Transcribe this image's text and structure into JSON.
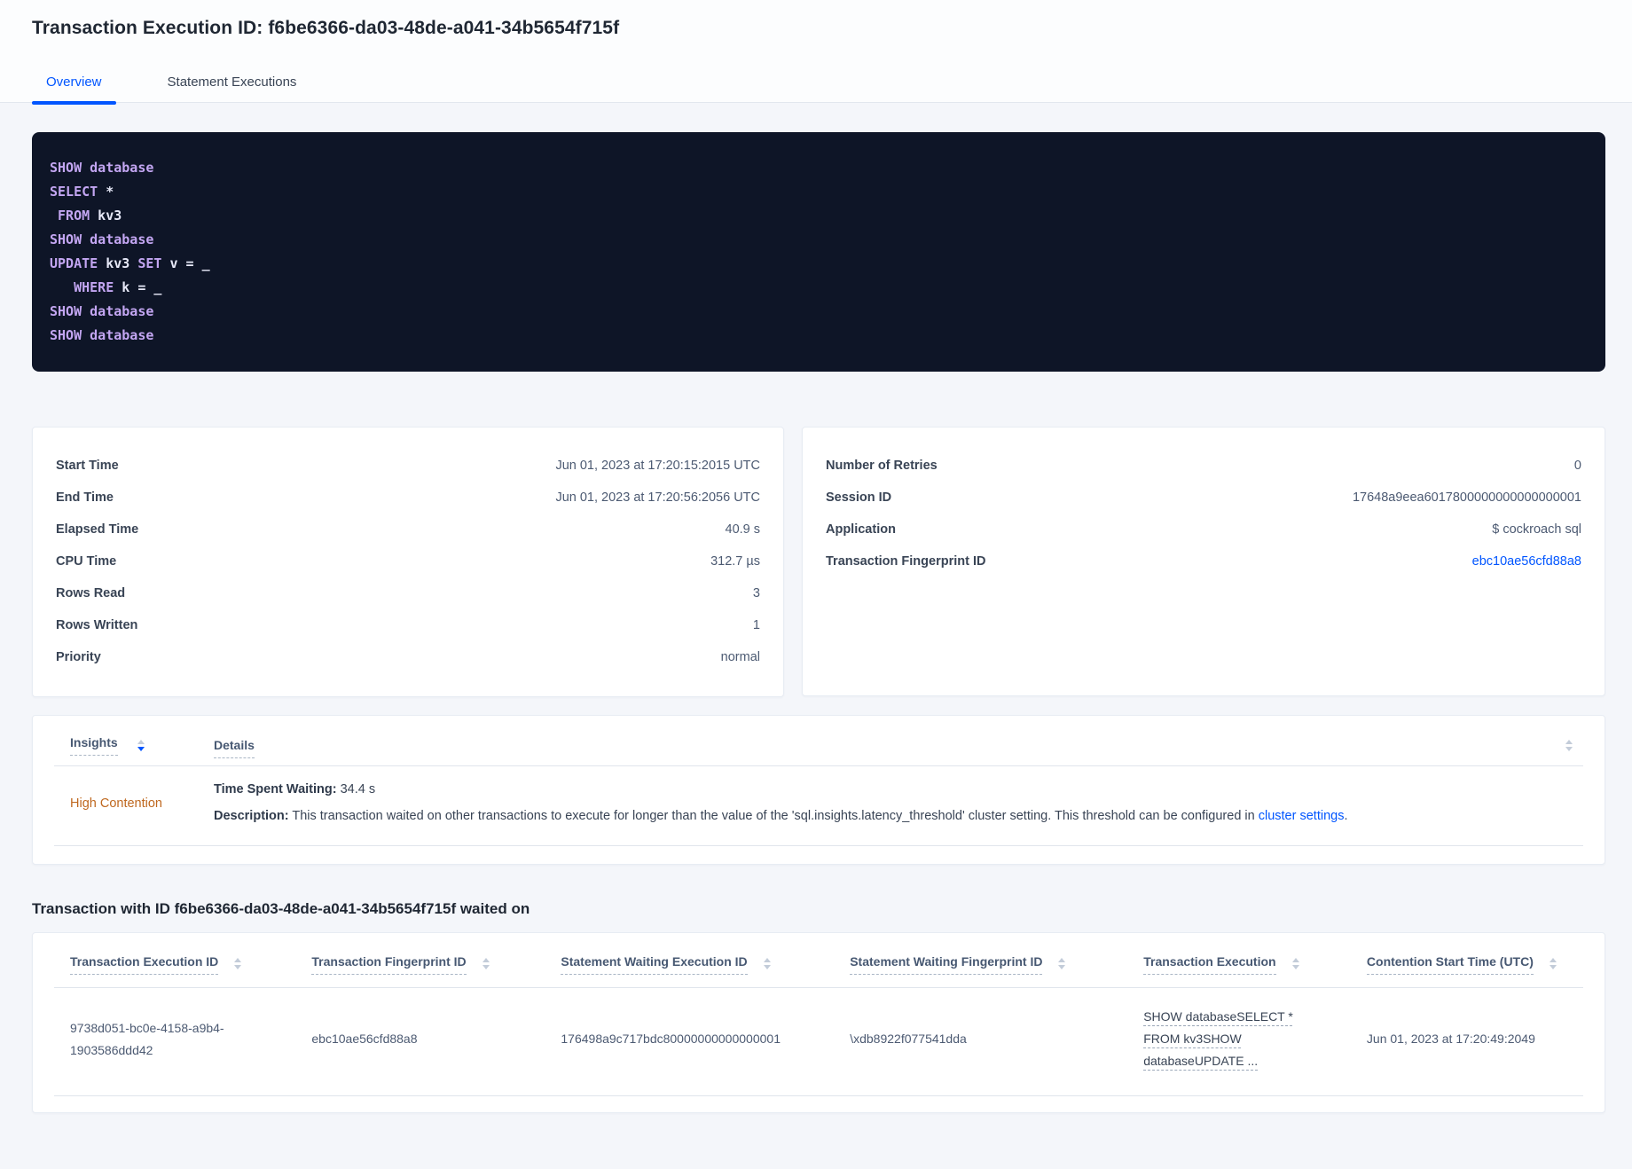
{
  "page": {
    "title": "Transaction Execution ID: f6be6366-da03-48de-a041-34b5654f715f"
  },
  "tabs": [
    {
      "label": "Overview",
      "active": true
    },
    {
      "label": "Statement Executions",
      "active": false
    }
  ],
  "colors": {
    "accent_blue": "#0055ff",
    "high_contention_orange": "#bf681f",
    "code_background": "#0e1527",
    "code_keyword": "#c3a6f2"
  },
  "sql_block": {
    "lines": [
      [
        {
          "t": "SHOW",
          "k": true
        },
        {
          "t": " database",
          "k": true
        }
      ],
      [
        {
          "t": "SELECT",
          "k": true
        },
        {
          "t": " *",
          "k": false
        }
      ],
      [
        {
          "t": " FROM",
          "k": true
        },
        {
          "t": " kv3",
          "k": false
        }
      ],
      [
        {
          "t": "SHOW",
          "k": true
        },
        {
          "t": " database",
          "k": true
        }
      ],
      [
        {
          "t": "UPDATE",
          "k": true
        },
        {
          "t": " kv3 ",
          "k": false
        },
        {
          "t": "SET",
          "k": true
        },
        {
          "t": " v = _",
          "k": false
        }
      ],
      [
        {
          "t": "   WHERE",
          "k": true
        },
        {
          "t": " k = _",
          "k": false
        }
      ],
      [
        {
          "t": "SHOW",
          "k": true
        },
        {
          "t": " database",
          "k": true
        }
      ],
      [
        {
          "t": "SHOW",
          "k": true
        },
        {
          "t": " database",
          "k": true
        }
      ]
    ]
  },
  "execution_details": {
    "rows": [
      {
        "label": "Start Time",
        "value": "Jun 01, 2023 at 17:20:15:2015 UTC"
      },
      {
        "label": "End Time",
        "value": "Jun 01, 2023 at 17:20:56:2056 UTC"
      },
      {
        "label": "Elapsed Time",
        "value": "40.9 s"
      },
      {
        "label": "CPU Time",
        "value": "312.7 µs"
      },
      {
        "label": "Rows Read",
        "value": "3"
      },
      {
        "label": "Rows Written",
        "value": "1"
      },
      {
        "label": "Priority",
        "value": "normal"
      }
    ]
  },
  "additional_details": {
    "rows": [
      {
        "label": "Number of Retries",
        "value": "0"
      },
      {
        "label": "Session ID",
        "value": "17648a9eea6017800000000000000001"
      },
      {
        "label": "Application",
        "value": "$ cockroach sql"
      },
      {
        "label": "Transaction Fingerprint ID",
        "value": "ebc10ae56cfd88a8",
        "link": true
      }
    ]
  },
  "insights_table": {
    "insights_header": "Insights",
    "details_header": "Details",
    "row": {
      "insight": "High Contention",
      "time_spent_waiting_label": "Time Spent Waiting:",
      "time_spent_waiting_value": " 34.4 s",
      "description_label": "Description:",
      "description_text": " This transaction waited on other transactions to execute for longer than the value of the 'sql.insights.latency_threshold' cluster setting. This threshold can be configured in ",
      "description_link": "cluster settings",
      "description_suffix": "."
    }
  },
  "waited_on": {
    "heading": "Transaction with ID f6be6366-da03-48de-a041-34b5654f715f waited on",
    "columns": [
      {
        "label": "Transaction Execution ID",
        "key": "transaction_execution_id"
      },
      {
        "label": "Transaction Fingerprint ID",
        "key": "transaction_fingerprint_id"
      },
      {
        "label": "Statement Waiting Execution ID",
        "key": "statement_waiting_execution_id"
      },
      {
        "label": "Statement Waiting Fingerprint ID",
        "key": "statement_waiting_fingerprint_id"
      },
      {
        "label": "Transaction Execution",
        "key": "transaction_execution"
      },
      {
        "label": "Contention Start Time (UTC)",
        "key": "contention_start_time"
      }
    ],
    "rows": [
      {
        "transaction_execution_id": "9738d051-bc0e-4158-a9b4-1903586ddd42",
        "transaction_fingerprint_id": "ebc10ae56cfd88a8",
        "statement_waiting_execution_id": "176498a9c717bdc80000000000000001",
        "statement_waiting_fingerprint_id": "\\xdb8922f077541dda",
        "transaction_execution": "SHOW databaseSELECT * FROM kv3SHOW databaseUPDATE ...",
        "contention_start_time": "Jun 01, 2023 at 17:20:49:2049"
      }
    ]
  }
}
